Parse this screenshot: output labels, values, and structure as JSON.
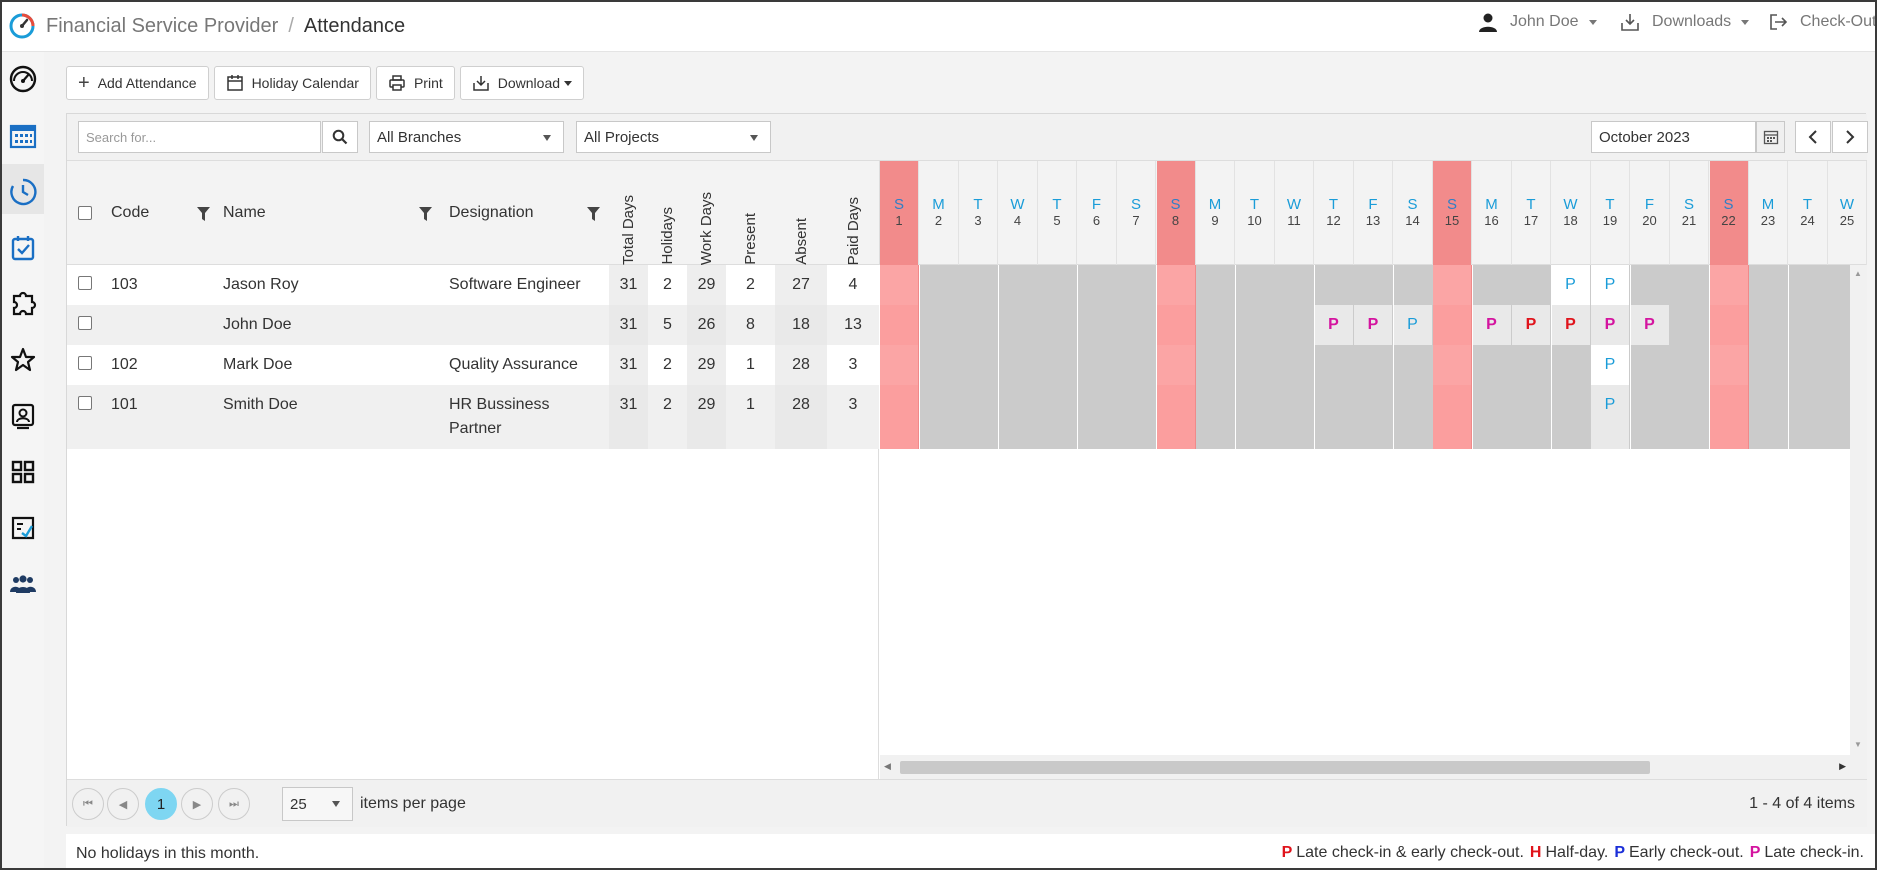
{
  "header": {
    "app_name": "Financial Service Provider",
    "page": "Attendance",
    "user": "John Doe",
    "downloads": "Downloads",
    "checkout": "Check-Out"
  },
  "toolbar": {
    "add": "Add Attendance",
    "holiday": "Holiday Calendar",
    "print": "Print",
    "download": "Download"
  },
  "filters": {
    "search_placeholder": "Search for...",
    "branches": "All Branches",
    "projects": "All Projects",
    "month": "October 2023"
  },
  "columns": {
    "code": "Code",
    "name": "Name",
    "designation": "Designation",
    "total_days": "Total Days",
    "holidays": "Holidays",
    "work_days": "Work Days",
    "present": "Present",
    "absent": "Absent",
    "paid_days": "Paid Days"
  },
  "days": [
    {
      "l": "S",
      "n": "1",
      "w": true
    },
    {
      "l": "M",
      "n": "2"
    },
    {
      "l": "T",
      "n": "3"
    },
    {
      "l": "W",
      "n": "4"
    },
    {
      "l": "T",
      "n": "5"
    },
    {
      "l": "F",
      "n": "6"
    },
    {
      "l": "S",
      "n": "7"
    },
    {
      "l": "S",
      "n": "8",
      "w": true
    },
    {
      "l": "M",
      "n": "9"
    },
    {
      "l": "T",
      "n": "10"
    },
    {
      "l": "W",
      "n": "11"
    },
    {
      "l": "T",
      "n": "12"
    },
    {
      "l": "F",
      "n": "13"
    },
    {
      "l": "S",
      "n": "14"
    },
    {
      "l": "S",
      "n": "15",
      "w": true
    },
    {
      "l": "M",
      "n": "16"
    },
    {
      "l": "T",
      "n": "17"
    },
    {
      "l": "W",
      "n": "18"
    },
    {
      "l": "T",
      "n": "19"
    },
    {
      "l": "F",
      "n": "20"
    },
    {
      "l": "S",
      "n": "21"
    },
    {
      "l": "S",
      "n": "22",
      "w": true
    },
    {
      "l": "M",
      "n": "23"
    },
    {
      "l": "T",
      "n": "24"
    },
    {
      "l": "W",
      "n": "25"
    }
  ],
  "rows": [
    {
      "code": "103",
      "name": "Jason Roy",
      "designation": "Software Engineer",
      "total_days": "31",
      "holidays": "2",
      "work_days": "29",
      "present": "2",
      "absent": "27",
      "paid_days": "4",
      "marks": {
        "18": "P",
        "19": "P"
      },
      "colors": {
        "18": "#1a9cd8",
        "19": "#1a9cd8"
      }
    },
    {
      "code": "",
      "name": "John Doe",
      "designation": "",
      "total_days": "31",
      "holidays": "5",
      "work_days": "26",
      "present": "8",
      "absent": "18",
      "paid_days": "13",
      "marks": {
        "12": "P",
        "13": "P",
        "14": "P",
        "16": "P",
        "17": "P",
        "18": "P",
        "19": "P",
        "20": "P"
      },
      "colors": {
        "12": "#d4149f",
        "13": "#d4149f",
        "14": "#1a9cd8",
        "16": "#d4149f",
        "17": "#e0141c",
        "18": "#e0141c",
        "19": "#d4149f",
        "20": "#d4149f"
      }
    },
    {
      "code": "102",
      "name": "Mark Doe",
      "designation": "Quality Assurance",
      "total_days": "31",
      "holidays": "2",
      "work_days": "29",
      "present": "1",
      "absent": "28",
      "paid_days": "3",
      "marks": {
        "19": "P"
      },
      "colors": {
        "19": "#1a9cd8"
      }
    },
    {
      "code": "101",
      "name": "Smith Doe",
      "designation": "HR Bussiness Partner",
      "total_days": "31",
      "holidays": "2",
      "work_days": "29",
      "present": "1",
      "absent": "28",
      "paid_days": "3",
      "marks": {
        "19": "P"
      },
      "colors": {
        "19": "#1a9cd8"
      }
    }
  ],
  "pager": {
    "current_page": "1",
    "page_size": "25",
    "per_page_label": "items per page",
    "summary": "1 - 4 of 4 items"
  },
  "footer": {
    "note": "No holidays in this month.",
    "legend": [
      {
        "letter": "P",
        "text": "Late check-in & early check-out.",
        "color": "#e0141c"
      },
      {
        "letter": "H",
        "text": "Half-day.",
        "color": "#e0141c"
      },
      {
        "letter": "P",
        "text": "Early check-out.",
        "color": "#1b2fd8"
      },
      {
        "letter": "P",
        "text": "Late check-in.",
        "color": "#d4149f"
      }
    ]
  }
}
